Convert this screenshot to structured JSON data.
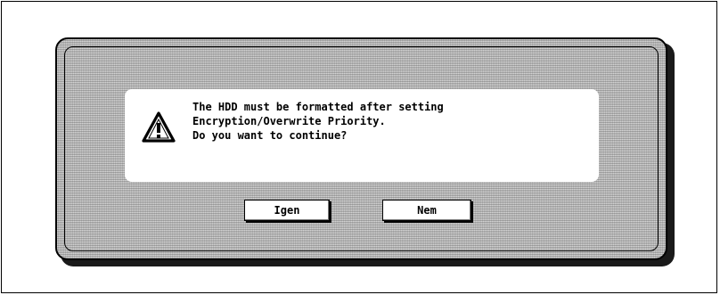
{
  "dialog": {
    "icon": "warning-triangle-icon",
    "message_lines": [
      "The HDD must be formatted after setting",
      "Encryption/Overwrite Priority.",
      "Do you want to continue?"
    ],
    "buttons": {
      "yes_label": "Igen",
      "no_label": "Nem"
    }
  },
  "colors": {
    "dialog_background": "#bdbdbd",
    "panel_background": "#ffffff",
    "border": "#000000"
  }
}
